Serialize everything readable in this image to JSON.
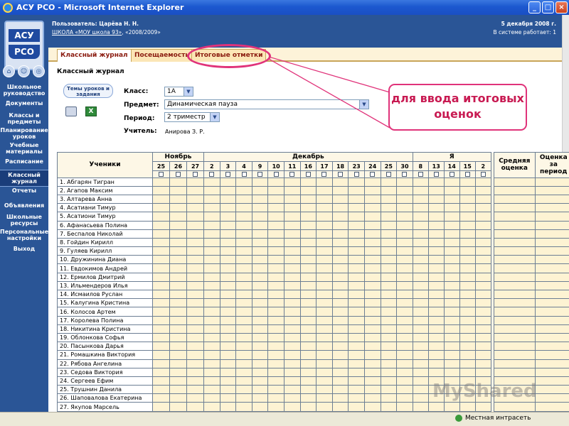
{
  "window": {
    "title": "АСУ РСО - Microsoft Internet Explorer",
    "min": "_",
    "max": "□",
    "close": "×"
  },
  "logo": {
    "line1": "АСУ",
    "line2": "РСО"
  },
  "header": {
    "user": "Пользователь: Царёва Н. Н.",
    "school_link": "ШКОЛА «МОУ школа 93»",
    "year": ", «2008/2009»",
    "date": "5 декабря 2008 г.",
    "online": "В системе работает:  1"
  },
  "sidebar": {
    "items": [
      "Школьное руководство",
      "Документы",
      "Классы и предметы",
      "Планирование уроков",
      "Учебные материалы",
      "Расписание",
      "Классный журнал",
      "Отчеты",
      "Объявления",
      "Школьные ресурсы",
      "Персональные настройки",
      "Выход"
    ]
  },
  "tabs": [
    "Классный журнал",
    "Посещаемость",
    "Итоговые отметки"
  ],
  "page": {
    "title": "Классный журнал",
    "themes_button": "Темы уроков и задания",
    "class_label": "Класс:",
    "class_value": "1А",
    "subject_label": "Предмет:",
    "subject_value": "Динамическая пауза",
    "period_label": "Период:",
    "period_value": "2 триместр",
    "teacher_label": "Учитель:",
    "teacher_value": "Анирова З. Р."
  },
  "callout": {
    "text": "для ввода итоговых оценок"
  },
  "grid": {
    "students_header": "Ученики",
    "months": [
      {
        "name": "Ноябрь"
      },
      {
        "name": "Декабрь"
      },
      {
        "name": "Я"
      }
    ],
    "dates": [
      "25",
      "26",
      "27",
      "2",
      "3",
      "4",
      "9",
      "10",
      "11",
      "16",
      "17",
      "18",
      "23",
      "24",
      "25",
      "30",
      "8",
      "13",
      "14",
      "15",
      "2"
    ],
    "avg_header": "Средняя оценка",
    "final_header": "Оценка за период",
    "students": [
      "1. Абгарян Тигран",
      "2. Агапов Максим",
      "3. Алтарева Анна",
      "4. Асатиани Тимур",
      "5. Асатиони Тимур",
      "6. Афанасьева Полина",
      "7. Беспалов Николай",
      "8. Гойдин Кирилл",
      "9. Гуляев Кирилл",
      "10. Дружинина Диана",
      "11. Евдокимов Андрей",
      "12. Ермилов Дмитрий",
      "13. Ильмендеров Илья",
      "14. Исмаилов Руслан",
      "15. Калугина Кристина",
      "16. Колосов Артем",
      "17. Королева Полина",
      "18. Никитина Кристина",
      "19. Облонкова Софья",
      "20. Пасынкова Дарья",
      "21. Ромашкина Виктория",
      "22. Рябова Ангелина",
      "23. Седова Виктория",
      "24. Сергеев Ефим",
      "25. Трушнин Данила",
      "26. Шаповалова Екатерина",
      "27. Якупов Марсель"
    ]
  },
  "status": {
    "zone": "Местная интрасеть"
  },
  "watermark": "MyShared"
}
